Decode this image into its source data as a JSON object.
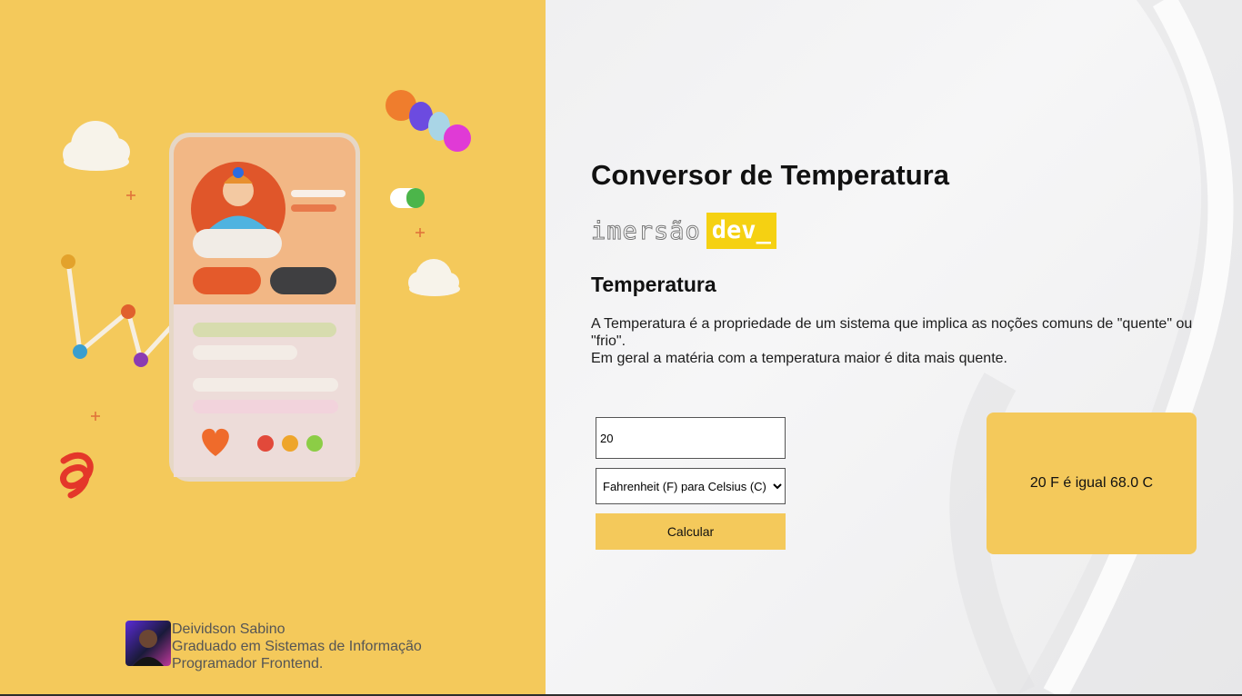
{
  "page": {
    "title": "Conversor de Temperatura",
    "brand": {
      "word": "imersão",
      "tag": "dev_"
    },
    "section_title": "Temperatura",
    "description_line1": "A Temperatura é a propriedade de um sistema que implica as noções comuns de \"quente\" ou \"frio\".",
    "description_line2": "Em geral a matéria com a temperatura maior é dita mais quente."
  },
  "form": {
    "input_value": "20",
    "select_selected": "Fahrenheit (F) para Celsius (C)",
    "button_label": "Calcular"
  },
  "result": {
    "text": "20 F é igual 68.0 C"
  },
  "author": {
    "name": "Deividson Sabino",
    "line2": "Graduado em Sistemas de Informação",
    "line3": "Programador Frontend."
  },
  "colors": {
    "accent": "#f4c95b",
    "dev_yellow": "#f5d112",
    "background": "#f3f3f4"
  },
  "icons": [
    "phone-illustration-icon",
    "avatar-photo"
  ]
}
